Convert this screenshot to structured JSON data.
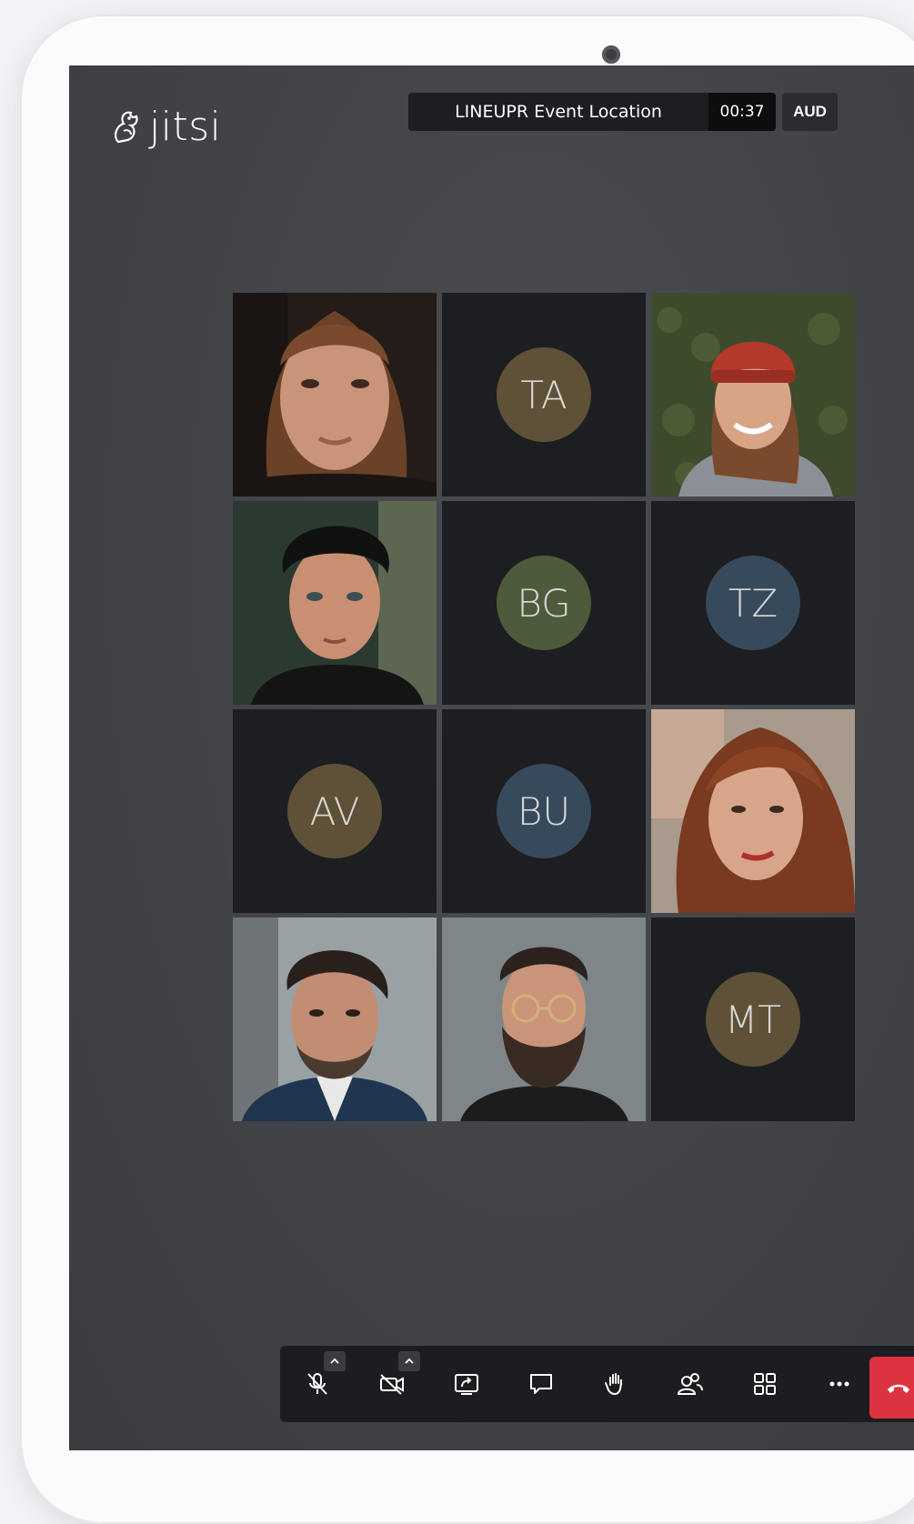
{
  "app": {
    "logo_text": "jitsi"
  },
  "meeting": {
    "subject": "LINEUPR Event Location",
    "timer": "00:37",
    "badge": "AUD"
  },
  "participants": [
    {
      "type": "video",
      "name": "participant-video-1"
    },
    {
      "type": "avatar",
      "initials": "TA",
      "color": "#5e5138"
    },
    {
      "type": "video",
      "name": "participant-video-2"
    },
    {
      "type": "video",
      "name": "participant-video-3"
    },
    {
      "type": "avatar",
      "initials": "BG",
      "color": "#4e5a3c"
    },
    {
      "type": "avatar",
      "initials": "TZ",
      "color": "#374a5c"
    },
    {
      "type": "avatar",
      "initials": "AV",
      "color": "#5e5138"
    },
    {
      "type": "avatar",
      "initials": "BU",
      "color": "#374a5c"
    },
    {
      "type": "video",
      "name": "participant-video-4"
    },
    {
      "type": "video",
      "name": "participant-video-5"
    },
    {
      "type": "video",
      "name": "participant-video-6"
    },
    {
      "type": "avatar",
      "initials": "MT",
      "color": "#5e5138"
    }
  ],
  "toolbar": {
    "buttons": [
      {
        "icon": "microphone-muted-icon",
        "caret": true
      },
      {
        "icon": "camera-off-icon",
        "caret": true
      },
      {
        "icon": "screen-share-icon"
      },
      {
        "icon": "chat-icon"
      },
      {
        "icon": "raise-hand-icon"
      },
      {
        "icon": "participants-icon"
      },
      {
        "icon": "tile-view-icon"
      },
      {
        "icon": "more-options-icon"
      }
    ],
    "hangup_color": "#dd3341"
  }
}
